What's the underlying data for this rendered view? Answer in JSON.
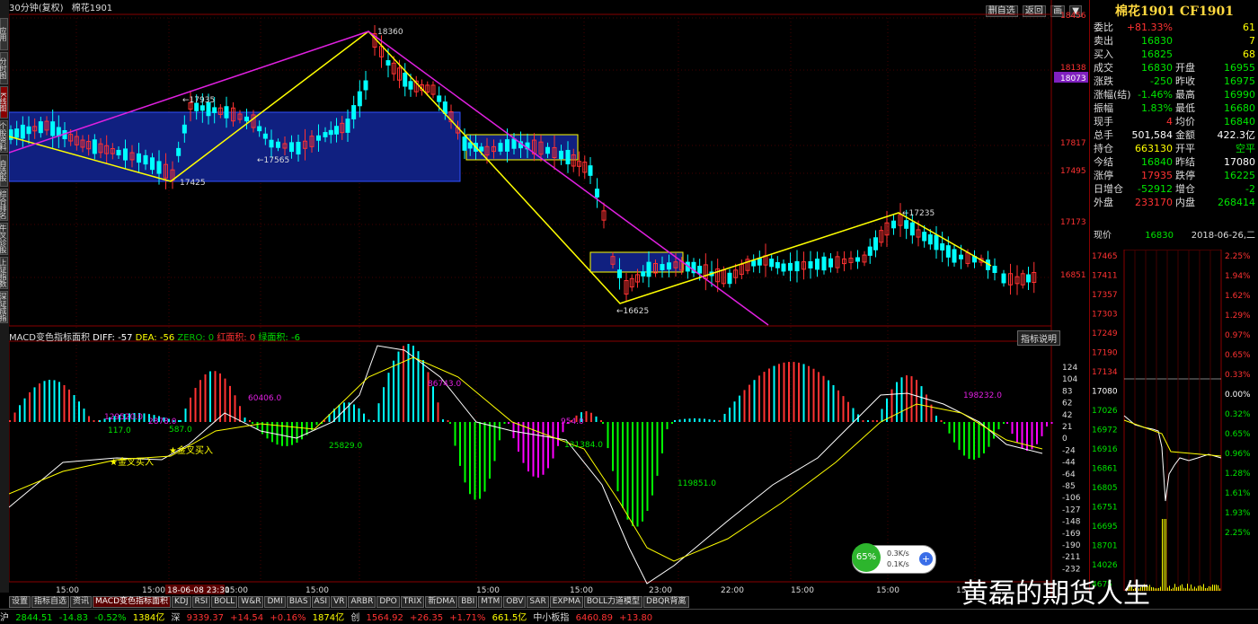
{
  "header": {
    "period": "30分钟(复权)",
    "name": "棉花1901"
  },
  "top_buttons": [
    "删自选",
    "返回",
    "画",
    "▼"
  ],
  "left_tabs": [
    "应用",
    "分时图",
    "K线图",
    "个股资料",
    "自选股",
    "综合排名",
    "牛叉诊股",
    "上证指数",
    "深证成指"
  ],
  "price_axis": [
    "18456",
    "18138",
    "18073",
    "17817",
    "17495",
    "17173",
    "16851"
  ],
  "annotations": {
    "high": "18360",
    "p17935": "←17935",
    "p17565": "←17565",
    "low1": "17425",
    "low2": "←16625",
    "p17235": "←17235"
  },
  "time_labels": [
    "15:00",
    "15:00",
    "15:00",
    "15:00",
    "15:00",
    "15:00",
    "23:00",
    "22:00",
    "15:00",
    "15:00",
    "15"
  ],
  "time_highlight": "18-06-08 23:30",
  "macd": {
    "header_name": "MACD变色指标面积",
    "diff": "DIFF: -57",
    "dea": "DEA: -56",
    "zero": "ZERO: 0",
    "red_area": "红面积: 0",
    "green_area": "绿面积: -6",
    "button": "指标说明",
    "labels": [
      "129520.0",
      "2878.0",
      "117.0",
      "587.0",
      "60406.0",
      "25829.0",
      "86743.0",
      "954.0",
      "131384.0",
      "119851.0",
      "198232.0"
    ],
    "signals": [
      "金叉买入",
      "金叉买入"
    ],
    "axis": [
      "124",
      "104",
      "83",
      "62",
      "42",
      "21",
      "0",
      "-24",
      "-44",
      "-64",
      "-85",
      "-106",
      "-127",
      "-148",
      "-169",
      "-190",
      "-211",
      "-232"
    ]
  },
  "quote": {
    "title": "棉花1901 CF1901",
    "rows": [
      {
        "l1": "委比",
        "v1": "+81.33%",
        "c1": "red",
        "v2": "61",
        "c2": "yel"
      },
      {
        "l1": "卖出",
        "v1": "16830",
        "c1": "green",
        "v2": "7",
        "c2": "yel"
      },
      {
        "l1": "买入",
        "v1": "16825",
        "c1": "green",
        "v2": "68",
        "c2": "yel"
      },
      {
        "l1": "成交",
        "v1": "16830",
        "c1": "green",
        "l2": "开盘",
        "v2": "16955",
        "c2": "green"
      },
      {
        "l1": "涨跌",
        "v1": "-250",
        "c1": "green",
        "l2": "昨收",
        "v2": "16975",
        "c2": "green"
      },
      {
        "l1": "涨幅(结)",
        "v1": "-1.46%",
        "c1": "green",
        "l2": "最高",
        "v2": "16990",
        "c2": "green"
      },
      {
        "l1": "振幅",
        "v1": "1.83%",
        "c1": "green",
        "l2": "最低",
        "v2": "16680",
        "c2": "green"
      },
      {
        "l1": "现手",
        "v1": "4",
        "c1": "red",
        "l2": "均价",
        "v2": "16840",
        "c2": "green"
      },
      {
        "l1": "总手",
        "v1": "501,584",
        "c1": "white",
        "l2": "金额",
        "v2": "422.3亿",
        "c2": "white"
      },
      {
        "l1": "持仓",
        "v1": "663130",
        "c1": "yel",
        "l2": "开平",
        "v2": "空平",
        "c2": "green"
      },
      {
        "l1": "今结",
        "v1": "16840",
        "c1": "green",
        "l2": "昨结",
        "v2": "17080",
        "c2": "white"
      },
      {
        "l1": "涨停",
        "v1": "17935",
        "c1": "red",
        "l2": "跌停",
        "v2": "16225",
        "c2": "green"
      },
      {
        "l1": "日增仓",
        "v1": "-52912",
        "c1": "green",
        "l2": "增仓",
        "v2": "-2",
        "c2": "green"
      },
      {
        "l1": "外盘",
        "v1": "233170",
        "c1": "red",
        "l2": "内盘",
        "v2": "268414",
        "c2": "green"
      }
    ],
    "price_label": "现价",
    "price_value": "16830",
    "date": "2018-06-26,二"
  },
  "intraday": {
    "left_axis": [
      "17465",
      "17411",
      "17357",
      "17303",
      "17249",
      "17190",
      "17134",
      "17080",
      "17026",
      "16972",
      "16916",
      "16861",
      "16805",
      "16751",
      "16695",
      "18701",
      "14026",
      "4675"
    ],
    "right_axis": [
      "2.25%",
      "1.94%",
      "1.62%",
      "1.29%",
      "0.97%",
      "0.65%",
      "0.33%",
      "0.00%",
      "0.32%",
      "0.65%",
      "0.96%",
      "1.28%",
      "1.61%",
      "1.93%",
      "2.25%"
    ]
  },
  "tabs": [
    "设置",
    "指标自选",
    "资讯",
    "MACD变色指标面积",
    "KDJ",
    "RSI",
    "BOLL",
    "W&R",
    "DMI",
    "BIAS",
    "ASI",
    "VR",
    "ARBR",
    "DPO",
    "TRIX",
    "新DMA",
    "BBI",
    "MTM",
    "OBV",
    "SAR",
    "EXPMA",
    "BOLL力道模型",
    "DBQR背离"
  ],
  "status": {
    "a1": "2844.51",
    "a2": "-14.83",
    "a3": "-0.52%",
    "a4": "1384亿",
    "b0": "深",
    "b1": "9339.37",
    "b2": "+14.54",
    "b3": "+0.16%",
    "b4": "1874亿",
    "c0": "创",
    "c1": "1564.92",
    "c2": "+26.35",
    "c3": "+1.71%",
    "c4": "661.5亿",
    "d0": "中小板指",
    "d1": "6460.89",
    "d2": "+13.80"
  },
  "net": {
    "pct": "65%",
    "up": "0.3K/s",
    "down": "0.1K/s"
  },
  "watermark": "黄磊的期货人生",
  "colors": {
    "up": "#ff3232",
    "down": "#00ffff",
    "box": "#1c2a8c",
    "zigzag": "#ffff00",
    "trend": "#e020e0"
  },
  "chart_data": {
    "type": "candlestick",
    "symbol": "CF1901",
    "period": "30分钟",
    "extremes": [
      {
        "label": "18360"
      },
      {
        "label": "17935"
      },
      {
        "label": "17565"
      },
      {
        "label": "17425"
      },
      {
        "label": "16625"
      },
      {
        "label": "17235"
      }
    ],
    "macd_diff": -57,
    "macd_dea": -56
  }
}
